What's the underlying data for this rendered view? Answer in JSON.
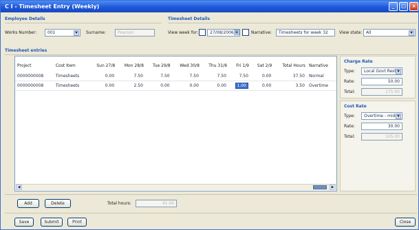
{
  "window": {
    "title": "C I - Timesheet Entry (Weekly)"
  },
  "employee": {
    "section_title": "Employee Details",
    "works_number_label": "Works Number:",
    "works_number_value": "001",
    "surname_label": "Surname:",
    "surname_value": "Pearson"
  },
  "timesheet_details": {
    "section_title": "Timesheet Details",
    "view_week_label": "View week for:",
    "view_week_value": "27/08/2006",
    "narrative_label": "Narrative:",
    "narrative_value": "Timesheets for week 32",
    "view_state_label": "View state:",
    "view_state_value": "All"
  },
  "entries": {
    "section_title": "Timesheet entries",
    "columns": [
      "Project",
      "Cost Item",
      "Sun 27/8",
      "Mon 28/8",
      "Tue 29/8",
      "Wed 30/8",
      "Thu 31/8",
      "Fri 1/9",
      "Sat 2/9",
      "Total Hours",
      "Narrative"
    ],
    "rows": [
      [
        "0000000008",
        "Timesheets",
        "0.00",
        "7.50",
        "7.50",
        "7.50",
        "7.50",
        "7.50",
        "0.00",
        "37.50",
        "Normal"
      ],
      [
        "0000000008",
        "Timesheets",
        "0.00",
        "2.50",
        "0.00",
        "0.00",
        "0.00",
        "1.00",
        "0.00",
        "3.50",
        "Overtime"
      ]
    ]
  },
  "charge_rate": {
    "section_title": "Charge Rate",
    "type_label": "Type:",
    "type_value": "Local Govt Rest",
    "rate_label": "Rate:",
    "rate_value": "50.00",
    "total_label": "Total:",
    "total_value": "175.00"
  },
  "cost_rate": {
    "section_title": "Cost Rate",
    "type_label": "Type:",
    "type_value": "Overtime - midr",
    "rate_label": "Rate:",
    "rate_value": "30.00",
    "total_label": "Total:",
    "total_value": "105.00"
  },
  "actions": {
    "add_label": "Add",
    "delete_label": "Delete",
    "total_hours_label": "Total hours:",
    "total_hours_value": "41.00"
  },
  "footer": {
    "save_label": "Save",
    "submit_label": "Submit",
    "print_label": "Print",
    "close_label": "Close"
  }
}
